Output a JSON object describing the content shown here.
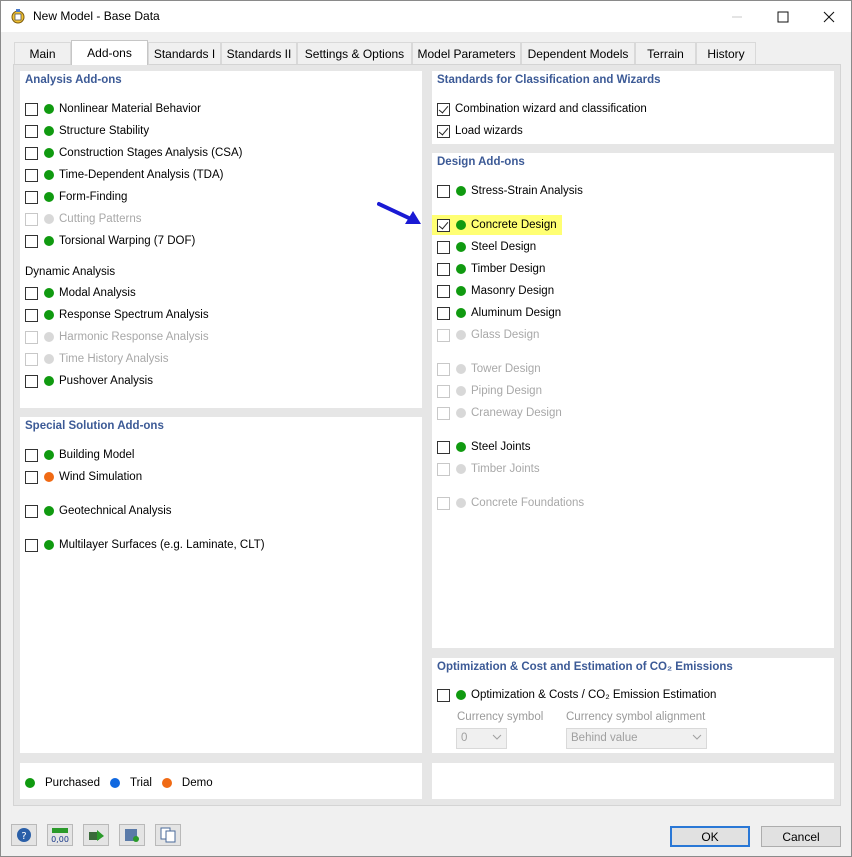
{
  "window": {
    "title": "New Model - Base Data"
  },
  "tabs": [
    {
      "label": "Main"
    },
    {
      "label": "Add-ons"
    },
    {
      "label": "Standards I"
    },
    {
      "label": "Standards II"
    },
    {
      "label": "Settings & Options"
    },
    {
      "label": "Model Parameters"
    },
    {
      "label": "Dependent Models"
    },
    {
      "label": "Terrain"
    },
    {
      "label": "History"
    }
  ],
  "colors": {
    "purchased": "#109a10",
    "trial": "#1068e0",
    "demo": "#f06a14",
    "disabled_dot": "#d8d8d8",
    "title_blue": "#3c5a96"
  },
  "analysis": {
    "title": "Analysis Add-ons",
    "items": [
      {
        "label": "Nonlinear Material Behavior",
        "checked": false,
        "status": "purchased"
      },
      {
        "label": "Structure Stability",
        "checked": false,
        "status": "purchased"
      },
      {
        "label": "Construction Stages Analysis (CSA)",
        "checked": false,
        "status": "purchased"
      },
      {
        "label": "Time-Dependent Analysis (TDA)",
        "checked": false,
        "status": "purchased"
      },
      {
        "label": "Form-Finding",
        "checked": false,
        "status": "purchased"
      },
      {
        "label": "Cutting Patterns",
        "checked": false,
        "status": "disabled"
      },
      {
        "label": "Torsional Warping (7 DOF)",
        "checked": false,
        "status": "purchased"
      }
    ],
    "dynamic_title": "Dynamic Analysis",
    "dynamic_items": [
      {
        "label": "Modal Analysis",
        "checked": false,
        "status": "purchased"
      },
      {
        "label": "Response Spectrum Analysis",
        "checked": false,
        "status": "purchased"
      },
      {
        "label": "Harmonic Response Analysis",
        "checked": false,
        "status": "disabled"
      },
      {
        "label": "Time History Analysis",
        "checked": false,
        "status": "disabled"
      },
      {
        "label": "Pushover Analysis",
        "checked": false,
        "status": "purchased"
      }
    ]
  },
  "special": {
    "title": "Special Solution Add-ons",
    "items": [
      {
        "label": "Building Model",
        "checked": false,
        "status": "purchased"
      },
      {
        "label": "Wind Simulation",
        "checked": false,
        "status": "demo"
      },
      {
        "label": "Geotechnical Analysis",
        "checked": false,
        "status": "purchased"
      },
      {
        "label": "Multilayer Surfaces (e.g. Laminate, CLT)",
        "checked": false,
        "status": "purchased"
      }
    ]
  },
  "standards": {
    "title": "Standards for Classification and Wizards",
    "items": [
      {
        "label": "Combination wizard and classification",
        "checked": true
      },
      {
        "label": "Load wizards",
        "checked": true
      }
    ]
  },
  "design": {
    "title": "Design Add-ons",
    "items": [
      {
        "label": "Stress-Strain Analysis",
        "checked": false,
        "status": "purchased"
      },
      {
        "label": "Concrete Design",
        "checked": true,
        "status": "purchased"
      },
      {
        "label": "Steel Design",
        "checked": false,
        "status": "purchased"
      },
      {
        "label": "Timber Design",
        "checked": false,
        "status": "purchased"
      },
      {
        "label": "Masonry Design",
        "checked": false,
        "status": "purchased"
      },
      {
        "label": "Aluminum Design",
        "checked": false,
        "status": "purchased"
      },
      {
        "label": "Glass Design",
        "checked": false,
        "status": "disabled"
      },
      {
        "label": "Tower Design",
        "checked": false,
        "status": "disabled"
      },
      {
        "label": "Piping Design",
        "checked": false,
        "status": "disabled"
      },
      {
        "label": "Craneway Design",
        "checked": false,
        "status": "disabled"
      },
      {
        "label": "Steel Joints",
        "checked": false,
        "status": "purchased"
      },
      {
        "label": "Timber Joints",
        "checked": false,
        "status": "disabled"
      },
      {
        "label": "Concrete Foundations",
        "checked": false,
        "status": "disabled"
      }
    ]
  },
  "optimization": {
    "title": "Optimization & Cost and Estimation of CO₂ Emissions",
    "item_label": "Optimization & Costs / CO₂ Emission Estimation",
    "currency_label": "Currency symbol",
    "currency_value": "0",
    "alignment_label": "Currency symbol alignment",
    "alignment_value": "Behind value"
  },
  "legend": {
    "purchased": "Purchased",
    "trial": "Trial",
    "demo": "Demo"
  },
  "footer": {
    "ok": "OK",
    "cancel": "Cancel"
  }
}
